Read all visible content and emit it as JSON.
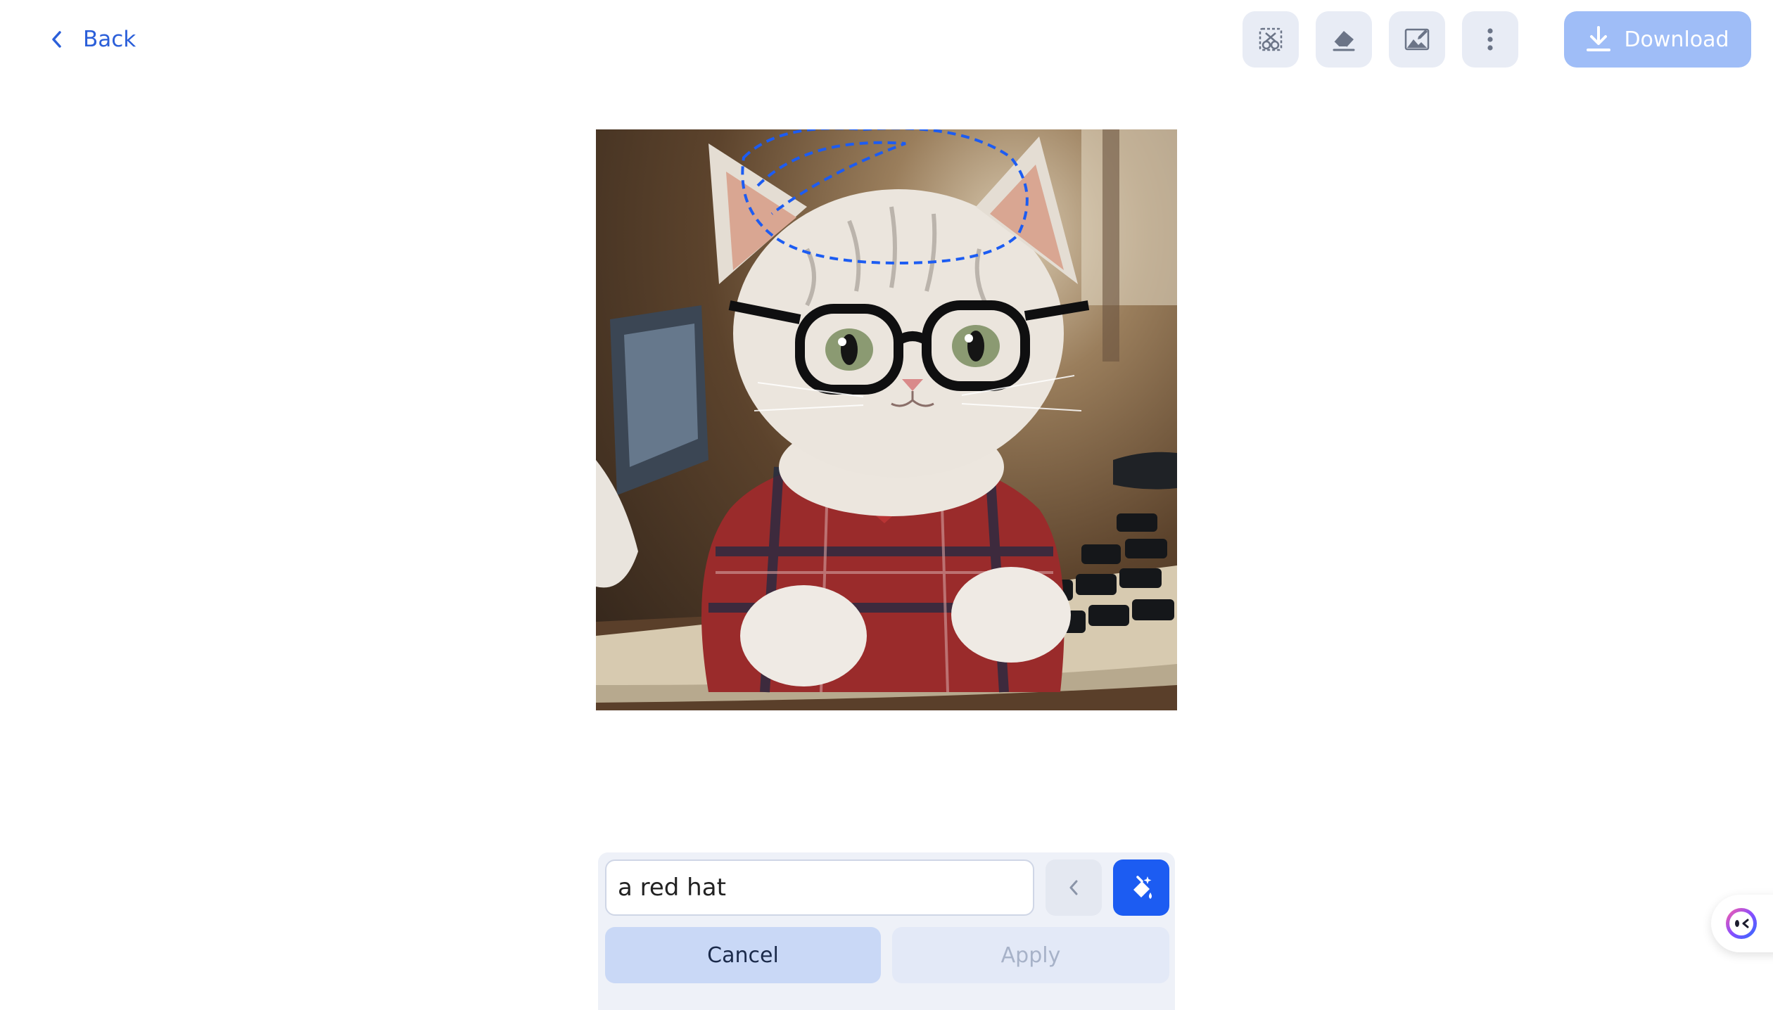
{
  "header": {
    "back_label": "Back",
    "tools": [
      {
        "icon": "object-select-icon"
      },
      {
        "icon": "eraser-icon"
      },
      {
        "icon": "image-edit-icon"
      },
      {
        "icon": "more-vertical-icon"
      }
    ],
    "download_label": "Download"
  },
  "canvas": {
    "image_subject": "kitten-with-glasses-at-keyboard",
    "selection_color": "#1c5cf2"
  },
  "prompt": {
    "value": "a red hat",
    "cancel_label": "Cancel",
    "apply_label": "Apply"
  },
  "colors": {
    "accent": "#1c5cf2",
    "download_disabled": "#9fbdf7",
    "link": "#2b5fd9"
  }
}
